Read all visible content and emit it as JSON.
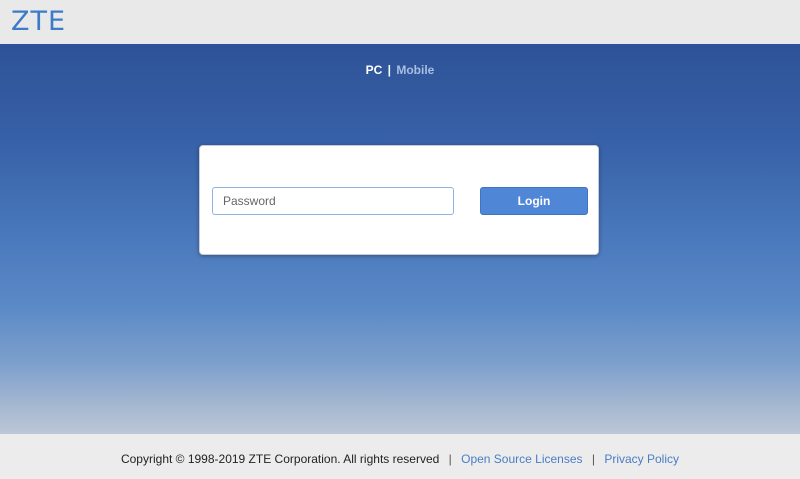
{
  "brand": {
    "logo_text": "ZTE",
    "logo_color": "#3b7bc8"
  },
  "mode_switch": {
    "pc_label": "PC",
    "separator": "|",
    "mobile_label": "Mobile"
  },
  "login": {
    "password_placeholder": "Password",
    "password_value": "",
    "login_label": "Login",
    "accent_color": "#4f86d6"
  },
  "footer": {
    "copyright": "Copyright © 1998-2019 ZTE Corporation. All rights reserved",
    "separator": "|",
    "open_source_label": "Open Source Licenses",
    "privacy_label": "Privacy Policy"
  }
}
